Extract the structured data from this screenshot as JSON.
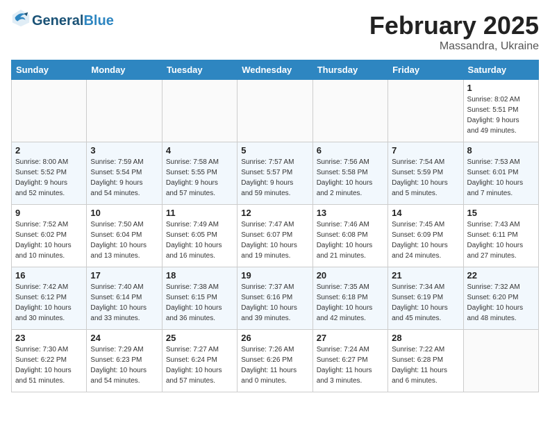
{
  "header": {
    "logo_line1": "General",
    "logo_line2": "Blue",
    "month": "February 2025",
    "location": "Massandra, Ukraine"
  },
  "weekdays": [
    "Sunday",
    "Monday",
    "Tuesday",
    "Wednesday",
    "Thursday",
    "Friday",
    "Saturday"
  ],
  "weeks": [
    [
      {
        "day": "",
        "info": ""
      },
      {
        "day": "",
        "info": ""
      },
      {
        "day": "",
        "info": ""
      },
      {
        "day": "",
        "info": ""
      },
      {
        "day": "",
        "info": ""
      },
      {
        "day": "",
        "info": ""
      },
      {
        "day": "1",
        "info": "Sunrise: 8:02 AM\nSunset: 5:51 PM\nDaylight: 9 hours\nand 49 minutes."
      }
    ],
    [
      {
        "day": "2",
        "info": "Sunrise: 8:00 AM\nSunset: 5:52 PM\nDaylight: 9 hours\nand 52 minutes."
      },
      {
        "day": "3",
        "info": "Sunrise: 7:59 AM\nSunset: 5:54 PM\nDaylight: 9 hours\nand 54 minutes."
      },
      {
        "day": "4",
        "info": "Sunrise: 7:58 AM\nSunset: 5:55 PM\nDaylight: 9 hours\nand 57 minutes."
      },
      {
        "day": "5",
        "info": "Sunrise: 7:57 AM\nSunset: 5:57 PM\nDaylight: 9 hours\nand 59 minutes."
      },
      {
        "day": "6",
        "info": "Sunrise: 7:56 AM\nSunset: 5:58 PM\nDaylight: 10 hours\nand 2 minutes."
      },
      {
        "day": "7",
        "info": "Sunrise: 7:54 AM\nSunset: 5:59 PM\nDaylight: 10 hours\nand 5 minutes."
      },
      {
        "day": "8",
        "info": "Sunrise: 7:53 AM\nSunset: 6:01 PM\nDaylight: 10 hours\nand 7 minutes."
      }
    ],
    [
      {
        "day": "9",
        "info": "Sunrise: 7:52 AM\nSunset: 6:02 PM\nDaylight: 10 hours\nand 10 minutes."
      },
      {
        "day": "10",
        "info": "Sunrise: 7:50 AM\nSunset: 6:04 PM\nDaylight: 10 hours\nand 13 minutes."
      },
      {
        "day": "11",
        "info": "Sunrise: 7:49 AM\nSunset: 6:05 PM\nDaylight: 10 hours\nand 16 minutes."
      },
      {
        "day": "12",
        "info": "Sunrise: 7:47 AM\nSunset: 6:07 PM\nDaylight: 10 hours\nand 19 minutes."
      },
      {
        "day": "13",
        "info": "Sunrise: 7:46 AM\nSunset: 6:08 PM\nDaylight: 10 hours\nand 21 minutes."
      },
      {
        "day": "14",
        "info": "Sunrise: 7:45 AM\nSunset: 6:09 PM\nDaylight: 10 hours\nand 24 minutes."
      },
      {
        "day": "15",
        "info": "Sunrise: 7:43 AM\nSunset: 6:11 PM\nDaylight: 10 hours\nand 27 minutes."
      }
    ],
    [
      {
        "day": "16",
        "info": "Sunrise: 7:42 AM\nSunset: 6:12 PM\nDaylight: 10 hours\nand 30 minutes."
      },
      {
        "day": "17",
        "info": "Sunrise: 7:40 AM\nSunset: 6:14 PM\nDaylight: 10 hours\nand 33 minutes."
      },
      {
        "day": "18",
        "info": "Sunrise: 7:38 AM\nSunset: 6:15 PM\nDaylight: 10 hours\nand 36 minutes."
      },
      {
        "day": "19",
        "info": "Sunrise: 7:37 AM\nSunset: 6:16 PM\nDaylight: 10 hours\nand 39 minutes."
      },
      {
        "day": "20",
        "info": "Sunrise: 7:35 AM\nSunset: 6:18 PM\nDaylight: 10 hours\nand 42 minutes."
      },
      {
        "day": "21",
        "info": "Sunrise: 7:34 AM\nSunset: 6:19 PM\nDaylight: 10 hours\nand 45 minutes."
      },
      {
        "day": "22",
        "info": "Sunrise: 7:32 AM\nSunset: 6:20 PM\nDaylight: 10 hours\nand 48 minutes."
      }
    ],
    [
      {
        "day": "23",
        "info": "Sunrise: 7:30 AM\nSunset: 6:22 PM\nDaylight: 10 hours\nand 51 minutes."
      },
      {
        "day": "24",
        "info": "Sunrise: 7:29 AM\nSunset: 6:23 PM\nDaylight: 10 hours\nand 54 minutes."
      },
      {
        "day": "25",
        "info": "Sunrise: 7:27 AM\nSunset: 6:24 PM\nDaylight: 10 hours\nand 57 minutes."
      },
      {
        "day": "26",
        "info": "Sunrise: 7:26 AM\nSunset: 6:26 PM\nDaylight: 11 hours\nand 0 minutes."
      },
      {
        "day": "27",
        "info": "Sunrise: 7:24 AM\nSunset: 6:27 PM\nDaylight: 11 hours\nand 3 minutes."
      },
      {
        "day": "28",
        "info": "Sunrise: 7:22 AM\nSunset: 6:28 PM\nDaylight: 11 hours\nand 6 minutes."
      },
      {
        "day": "",
        "info": ""
      }
    ]
  ]
}
